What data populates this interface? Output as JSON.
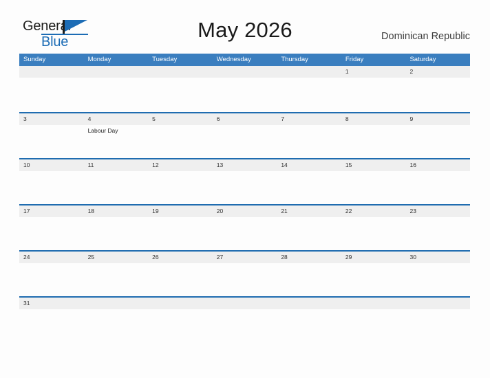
{
  "logo": {
    "primary_text": "General",
    "secondary_text": "Blue",
    "primary_color": "#1d1d1b",
    "accent_color": "#1c6cb5",
    "flag_icon": "flag-triangle-icon"
  },
  "header": {
    "title": "May 2026",
    "country": "Dominican Republic"
  },
  "theme": {
    "weekday_header_bg": "#3a7ebf",
    "weekday_header_text": "#ffffff",
    "row_divider": "#1f6cb0",
    "date_band_bg": "#efefef",
    "page_bg": "#fdfdfd",
    "date_text": "#2e2e2e"
  },
  "calendar": {
    "weekdays": [
      "Sunday",
      "Monday",
      "Tuesday",
      "Wednesday",
      "Thursday",
      "Friday",
      "Saturday"
    ],
    "weeks": [
      [
        {
          "day": "",
          "event": ""
        },
        {
          "day": "",
          "event": ""
        },
        {
          "day": "",
          "event": ""
        },
        {
          "day": "",
          "event": ""
        },
        {
          "day": "",
          "event": ""
        },
        {
          "day": "1",
          "event": ""
        },
        {
          "day": "2",
          "event": ""
        }
      ],
      [
        {
          "day": "3",
          "event": ""
        },
        {
          "day": "4",
          "event": "Labour Day"
        },
        {
          "day": "5",
          "event": ""
        },
        {
          "day": "6",
          "event": ""
        },
        {
          "day": "7",
          "event": ""
        },
        {
          "day": "8",
          "event": ""
        },
        {
          "day": "9",
          "event": ""
        }
      ],
      [
        {
          "day": "10",
          "event": ""
        },
        {
          "day": "11",
          "event": ""
        },
        {
          "day": "12",
          "event": ""
        },
        {
          "day": "13",
          "event": ""
        },
        {
          "day": "14",
          "event": ""
        },
        {
          "day": "15",
          "event": ""
        },
        {
          "day": "16",
          "event": ""
        }
      ],
      [
        {
          "day": "17",
          "event": ""
        },
        {
          "day": "18",
          "event": ""
        },
        {
          "day": "19",
          "event": ""
        },
        {
          "day": "20",
          "event": ""
        },
        {
          "day": "21",
          "event": ""
        },
        {
          "day": "22",
          "event": ""
        },
        {
          "day": "23",
          "event": ""
        }
      ],
      [
        {
          "day": "24",
          "event": ""
        },
        {
          "day": "25",
          "event": ""
        },
        {
          "day": "26",
          "event": ""
        },
        {
          "day": "27",
          "event": ""
        },
        {
          "day": "28",
          "event": ""
        },
        {
          "day": "29",
          "event": ""
        },
        {
          "day": "30",
          "event": ""
        }
      ],
      [
        {
          "day": "31",
          "event": ""
        },
        {
          "day": "",
          "event": ""
        },
        {
          "day": "",
          "event": ""
        },
        {
          "day": "",
          "event": ""
        },
        {
          "day": "",
          "event": ""
        },
        {
          "day": "",
          "event": ""
        },
        {
          "day": "",
          "event": ""
        }
      ]
    ]
  }
}
